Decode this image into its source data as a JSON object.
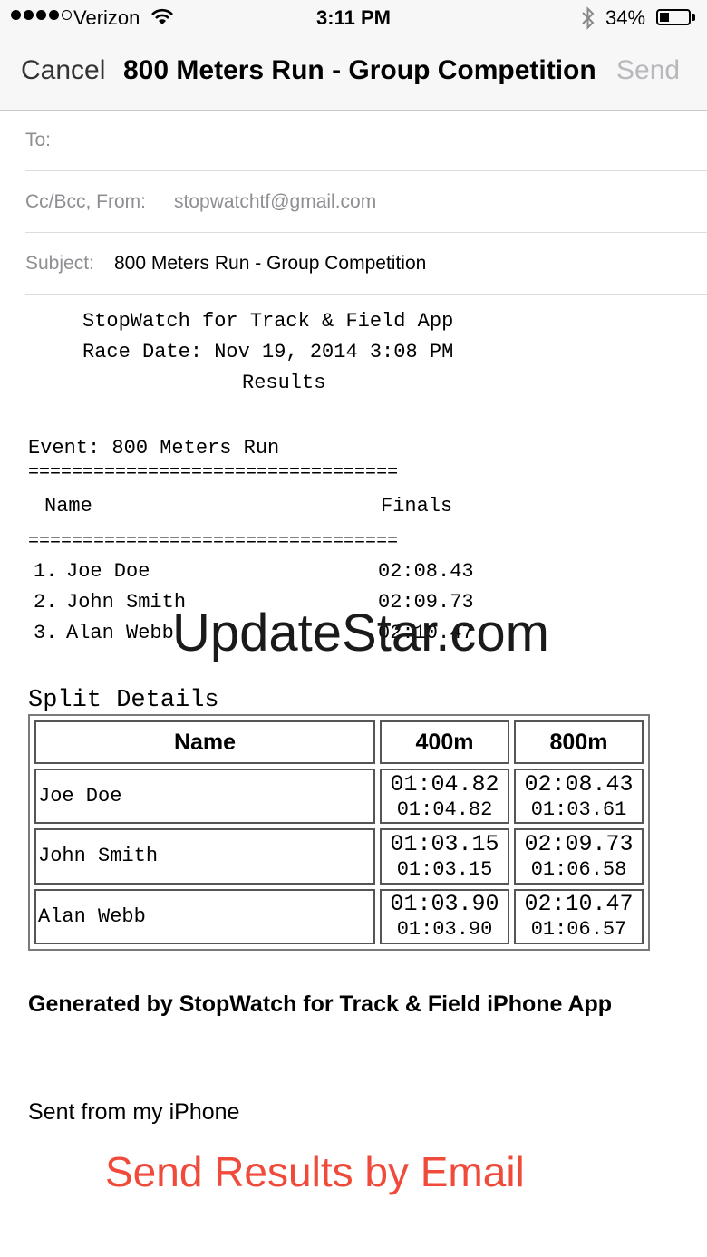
{
  "status_bar": {
    "carrier": "Verizon",
    "time": "3:11 PM",
    "battery_percent": "34%",
    "battery_level": 0.34,
    "signal_bars_filled": 4,
    "signal_bars_total": 5,
    "icons": [
      "wifi-icon",
      "bluetooth-icon",
      "battery-icon"
    ]
  },
  "nav": {
    "cancel_label": "Cancel",
    "title": "800 Meters Run - Group Competition",
    "send_label": "Send"
  },
  "fields": {
    "to_label": "To:",
    "cc_label": "Cc/Bcc, From:",
    "from_value": "stopwatchtf@gmail.com",
    "subject_label": "Subject:",
    "subject_value": "800 Meters Run - Group Competition"
  },
  "body": {
    "header_line1": "StopWatch for Track & Field App",
    "header_line2": "Race Date: Nov 19, 2014 3:08 PM",
    "header_line3": "Results",
    "event_line": "Event: 800 Meters Run",
    "rule": "==================================",
    "col_name": "Name",
    "col_finals": "Finals",
    "results": [
      {
        "rank": "1.",
        "name": "Joe Doe",
        "time": "02:08.43"
      },
      {
        "rank": "2.",
        "name": "John Smith",
        "time": "02:09.73"
      },
      {
        "rank": "3.",
        "name": "Alan Webb",
        "time": "02:10.47"
      }
    ],
    "split_title": "Split Details",
    "split_headers": [
      "Name",
      "400m",
      "800m"
    ],
    "splits": [
      {
        "name": "Joe Doe",
        "t400": "01:04.82",
        "s400": "01:04.82",
        "t800": "02:08.43",
        "s800": "01:03.61"
      },
      {
        "name": "John Smith",
        "t400": "01:03.15",
        "s400": "01:03.15",
        "t800": "02:09.73",
        "s800": "01:06.58"
      },
      {
        "name": "Alan Webb",
        "t400": "01:03.90",
        "s400": "01:03.90",
        "t800": "02:10.47",
        "s800": "01:06.57"
      }
    ],
    "generated": "Generated by StopWatch for Track & Field iPhone App",
    "signature": "Sent from my iPhone"
  },
  "watermark": "UpdateStar.com",
  "cta": "Send Results by Email",
  "colors": {
    "cta": "#f04a3b",
    "send_disabled": "#b8b8bd",
    "label_gray": "#8e8e93",
    "bar_bg": "#f7f7f7"
  }
}
